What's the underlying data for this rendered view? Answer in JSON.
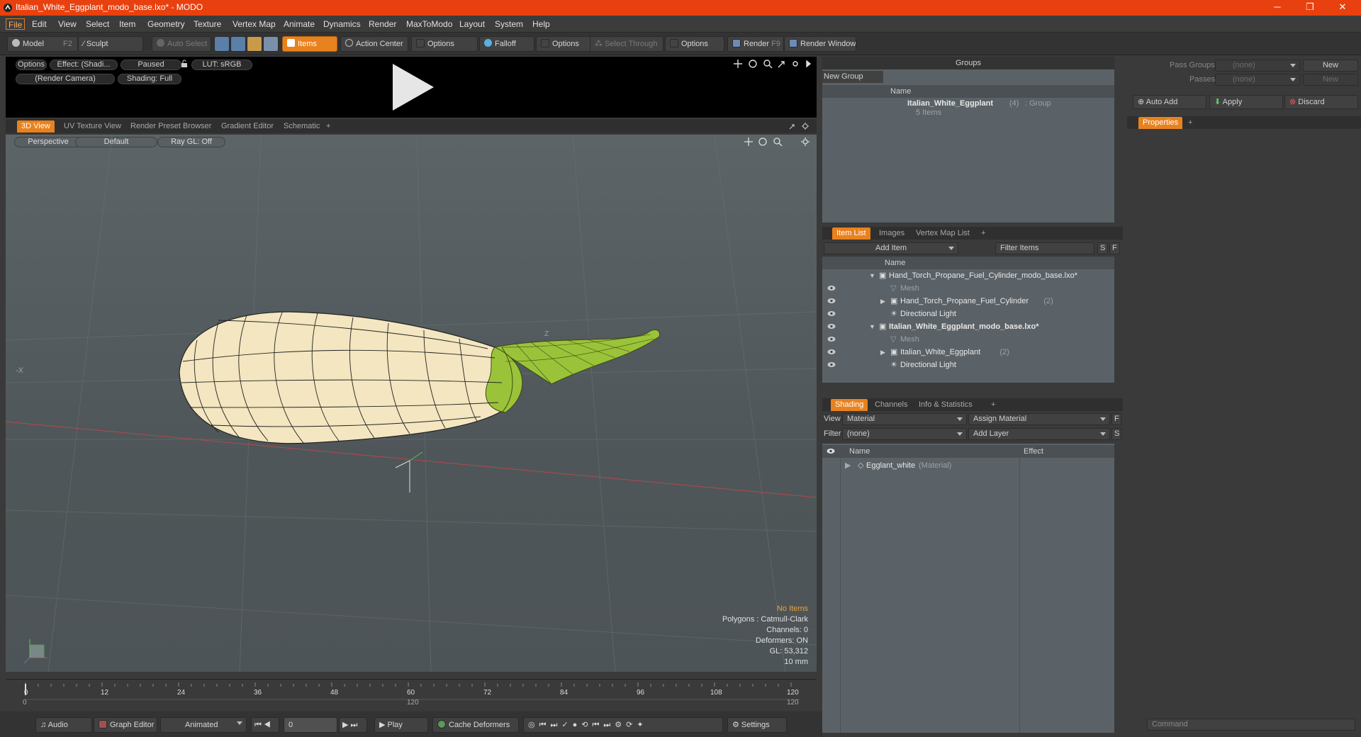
{
  "titlebar": {
    "title": "Italian_White_Eggplant_modo_base.lxo* - MODO",
    "minimize": "─",
    "restore": "❐",
    "close": "✕"
  },
  "menu": [
    "File",
    "Edit",
    "View",
    "Select",
    "Item",
    "Geometry",
    "Texture",
    "Vertex Map",
    "Animate",
    "Dynamics",
    "Render",
    "MaxToModo",
    "Layout",
    "System",
    "Help"
  ],
  "toolbar": {
    "model": "Model",
    "model_key": "F2",
    "sculpt": "Sculpt",
    "auto_select": "Auto Select",
    "items": "Items",
    "action_center": "Action Center",
    "options1": "Options",
    "falloff": "Falloff",
    "options2": "Options",
    "select_through": "Select Through",
    "options3": "Options",
    "render": "Render",
    "render_key": "F9",
    "render_window": "Render Window"
  },
  "preview": {
    "options": "Options",
    "effect": "Effect: (Shadi...",
    "paused": "Paused",
    "lut": "LUT: sRGB",
    "camera": "(Render Camera)",
    "shading": "Shading: Full"
  },
  "viewtabs": [
    "3D View",
    "UV Texture View",
    "Render Preset Browser",
    "Gradient Editor",
    "Schematic",
    "+"
  ],
  "viewport": {
    "perspective": "Perspective",
    "default": "Default",
    "raygl": "Ray GL: Off",
    "stats": {
      "no_items": "No Items",
      "polygons": "Polygons : Catmull-Clark",
      "channels": "Channels: 0",
      "deformers": "Deformers: ON",
      "gl": "GL: 53,312",
      "scale": "10 mm"
    },
    "axis_x": "-X",
    "axis_z": "Z"
  },
  "timeline": {
    "ticks": [
      "0",
      "12",
      "24",
      "36",
      "48",
      "60",
      "72",
      "84",
      "96",
      "108",
      "120"
    ],
    "start": "0",
    "end_mid": "120",
    "end": "120"
  },
  "bottombar": {
    "audio": "Audio",
    "graph_editor": "Graph Editor",
    "animated": "Animated",
    "frame": "0",
    "play": "Play",
    "cache_deformers": "Cache Deformers",
    "settings": "Settings"
  },
  "groups": {
    "title": "Groups",
    "new_group": "New Group",
    "col_name": "Name",
    "item_name": "Italian_White_Eggplant",
    "item_count": "(4)",
    "item_type": ": Group",
    "item_sub": "5 Items"
  },
  "passes": {
    "pass_groups_label": "Pass Groups",
    "pass_groups_value": "(none)",
    "new1": "New",
    "passes_label": "Passes",
    "passes_value": "(none)",
    "new2": "New",
    "auto_add": "Auto Add",
    "apply": "Apply",
    "discard": "Discard",
    "properties_tab": "Properties",
    "plus": "+"
  },
  "itemlist": {
    "tabs": [
      "Item List",
      "Images",
      "Vertex Map List",
      "+"
    ],
    "add_item": "Add Item",
    "filter": "Filter Items",
    "s": "S",
    "f": "F",
    "col_name": "Name",
    "rows": [
      {
        "name": "Hand_Torch_Propane_Fuel_Cylinder_modo_base.lxo*",
        "indent": 0,
        "tri": "▼"
      },
      {
        "name": "Mesh",
        "indent": 1,
        "dim": true
      },
      {
        "name": "Hand_Torch_Propane_Fuel_Cylinder",
        "extra": "(2)",
        "indent": 1,
        "tri": "▶"
      },
      {
        "name": "Directional Light",
        "indent": 1
      },
      {
        "name": "Italian_White_Eggplant_modo_base.lxo*",
        "indent": 0,
        "tri": "▼",
        "bold": true
      },
      {
        "name": "Mesh",
        "indent": 1,
        "dim": true
      },
      {
        "name": "Italian_White_Eggplant",
        "extra": "(2)",
        "indent": 1,
        "tri": "▶"
      },
      {
        "name": "Directional Light",
        "indent": 1
      }
    ]
  },
  "shading": {
    "tabs": [
      "Shading",
      "Channels",
      "Info & Statistics",
      "+"
    ],
    "view_label": "View",
    "view_value": "Material",
    "assign_material": "Assign Material",
    "f": "F",
    "filter_label": "Filter",
    "filter_value": "(none)",
    "add_layer": "Add Layer",
    "s": "S",
    "col_name": "Name",
    "col_effect": "Effect",
    "row_name": "Egglant_white",
    "row_type": "(Material)"
  },
  "command": {
    "placeholder": "Command"
  },
  "colors": {
    "accent": "#e8821e",
    "titlebar": "#e8410f",
    "eggplant": "#f3e6c0",
    "stem": "#9bc33a"
  }
}
